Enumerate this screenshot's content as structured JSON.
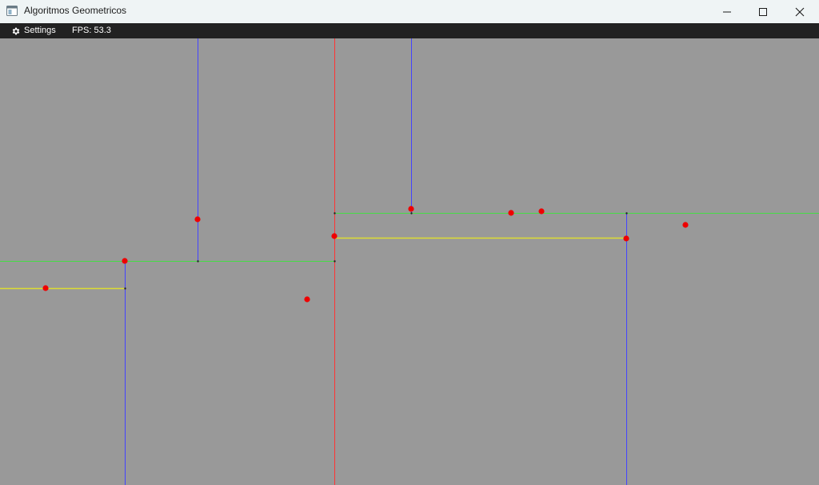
{
  "window": {
    "title": "Algoritmos Geometricos",
    "controls": [
      "minimize-icon",
      "maximize-icon",
      "close-icon"
    ]
  },
  "menubar": {
    "settings_label": "Settings",
    "settings_icon": "gear-icon",
    "fps_text": "FPS: 53.3"
  },
  "scene": {
    "background": "#999999",
    "colors": {
      "split_red": "#ff3333",
      "split_blue": "#4444ff",
      "split_green": "#44dd44",
      "split_yellow": "#dddd33",
      "point": "#ee0000"
    }
  }
}
